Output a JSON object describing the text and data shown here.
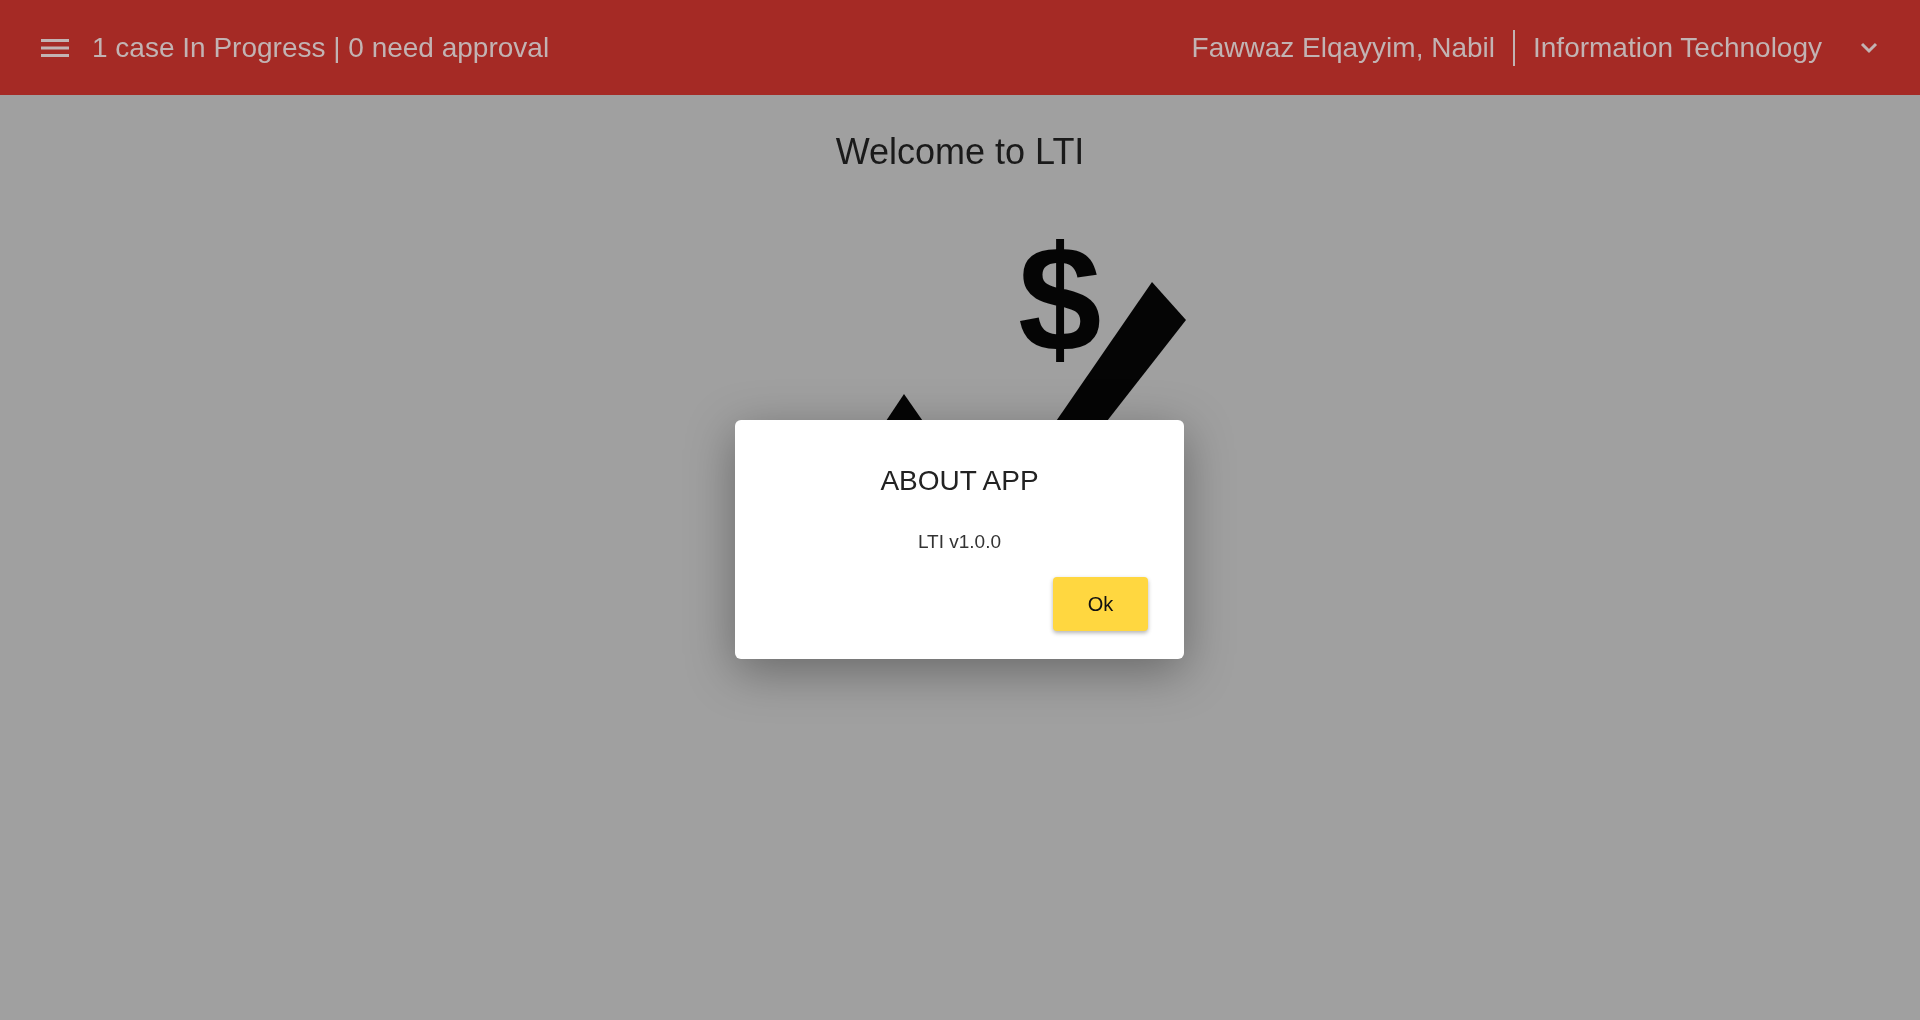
{
  "header": {
    "status": "1 case In Progress | 0 need approval",
    "user": "Fawwaz Elqayyim, Nabil",
    "department": "Information Technology"
  },
  "welcome": "Welcome to LTI",
  "logo": {
    "symbol": "$"
  },
  "dialog": {
    "title": "ABOUT APP",
    "message": "LTI v1.0.0",
    "button": "Ok"
  }
}
